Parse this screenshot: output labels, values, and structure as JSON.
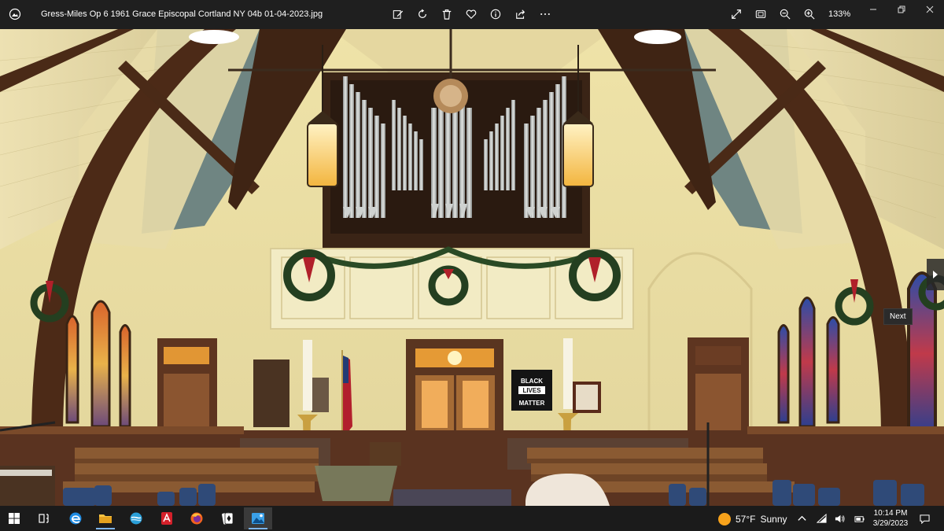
{
  "title_bar": {
    "file_name": "Gress-Miles Op 6 1961 Grace Episcopal Cortland NY 04b 01-04-2023.jpg",
    "zoom_level": "133%",
    "toolbar_icons": [
      "edit-icon",
      "rotate-icon",
      "delete-icon",
      "favorite-icon",
      "info-icon",
      "share-icon",
      "more-icon"
    ],
    "view_icons": [
      "fullscreen-icon",
      "fit-window-icon",
      "zoom-out-icon",
      "zoom-in-icon"
    ]
  },
  "photo": {
    "banner_line1": "BLACK",
    "banner_line2": "LIVES",
    "banner_line3": "MATTER"
  },
  "navigation": {
    "next_tooltip": "Next"
  },
  "taskbar": {
    "apps": [
      "windows-start-icon",
      "task-view-icon",
      "edge-legacy-icon",
      "file-explorer-icon",
      "mail-icon",
      "acrobat-icon",
      "firefox-icon",
      "solitaire-icon",
      "photos-icon"
    ],
    "weather_temp": "57°F",
    "weather_text": "Sunny",
    "time": "10:14 PM",
    "date": "3/29/2023"
  },
  "colors": {
    "accent": "#7eb4ea",
    "titlebar_bg": "#1f1f1f",
    "taskbar_bg": "#1b1b1b"
  }
}
